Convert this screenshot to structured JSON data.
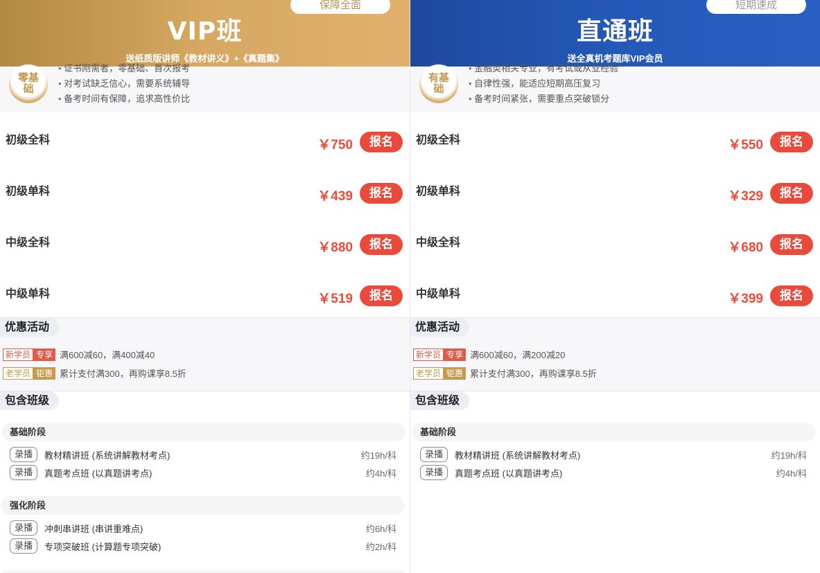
{
  "left": {
    "tag": "保障全面",
    "title": "VIP班",
    "subtitle": "送纸质版讲师《教材讲义》+《真题集》",
    "badge": "零基础",
    "profile": [
      "证书刚需者，零基础、首次报考",
      "对考试缺乏信心，需要系统辅导",
      "备考时间有保障，追求高性价比"
    ],
    "courses": [
      {
        "name": "初级全科",
        "price": "￥750",
        "button": "报名"
      },
      {
        "name": "初级单科",
        "price": "￥439",
        "button": "报名"
      },
      {
        "name": "中级全科",
        "price": "￥880",
        "button": "报名"
      },
      {
        "name": "中级单科",
        "price": "￥519",
        "button": "报名"
      }
    ],
    "promo": {
      "title": "优惠活动",
      "new_tag_a": "新学员",
      "new_tag_b": "专享",
      "new_text": "满600减60，满400减40",
      "old_tag_a": "老学员",
      "old_tag_b": "钜惠",
      "old_text": "累计支付满300，再购课享8.5折"
    },
    "included": {
      "title": "包含班级",
      "stages": [
        {
          "name": "基础阶段",
          "items": [
            {
              "tag": "录播",
              "name": "教材精讲班 (系统讲解教材考点)",
              "duration": "约19h/科"
            },
            {
              "tag": "录播",
              "name": "真题考点班 (以真题讲考点)",
              "duration": "约4h/科"
            }
          ]
        },
        {
          "name": "强化阶段",
          "items": [
            {
              "tag": "录播",
              "name": "冲刺串讲班 (串讲重难点)",
              "duration": "约6h/科"
            },
            {
              "tag": "录播",
              "name": "专项突破班 (计算题专项突破)",
              "duration": "约2h/科"
            }
          ]
        }
      ]
    }
  },
  "right": {
    "tag": "短期速成",
    "title": "直通班",
    "subtitle": "送全真机考题库VIP会员",
    "badge": "有基础",
    "profile": [
      "金融类相关专业，有考试或从业经验",
      "自律性强，能适应短期高压复习",
      "备考时间紧张，需要重点突破锁分"
    ],
    "courses": [
      {
        "name": "初级全科",
        "price": "￥550",
        "button": "报名"
      },
      {
        "name": "初级单科",
        "price": "￥329",
        "button": "报名"
      },
      {
        "name": "中级全科",
        "price": "￥680",
        "button": "报名"
      },
      {
        "name": "中级单科",
        "price": "￥399",
        "button": "报名"
      }
    ],
    "promo": {
      "title": "优惠活动",
      "new_tag_a": "新学员",
      "new_tag_b": "专享",
      "new_text": "满600减60，满200减20",
      "old_tag_a": "老学员",
      "old_tag_b": "钜惠",
      "old_text": "累计支付满300，再购课享8.5折"
    },
    "included": {
      "title": "包含班级",
      "stages": [
        {
          "name": "基础阶段",
          "items": [
            {
              "tag": "录播",
              "name": "教材精讲班 (系统讲解教材考点)",
              "duration": "约19h/科"
            },
            {
              "tag": "录播",
              "name": "真题考点班 (以真题讲考点)",
              "duration": "约4h/科"
            }
          ]
        }
      ]
    }
  },
  "colors": {
    "gold": "#d6a862",
    "blue": "#2458b8",
    "price_red": "#ee4b3b",
    "button_red": "#ea4a3c"
  }
}
